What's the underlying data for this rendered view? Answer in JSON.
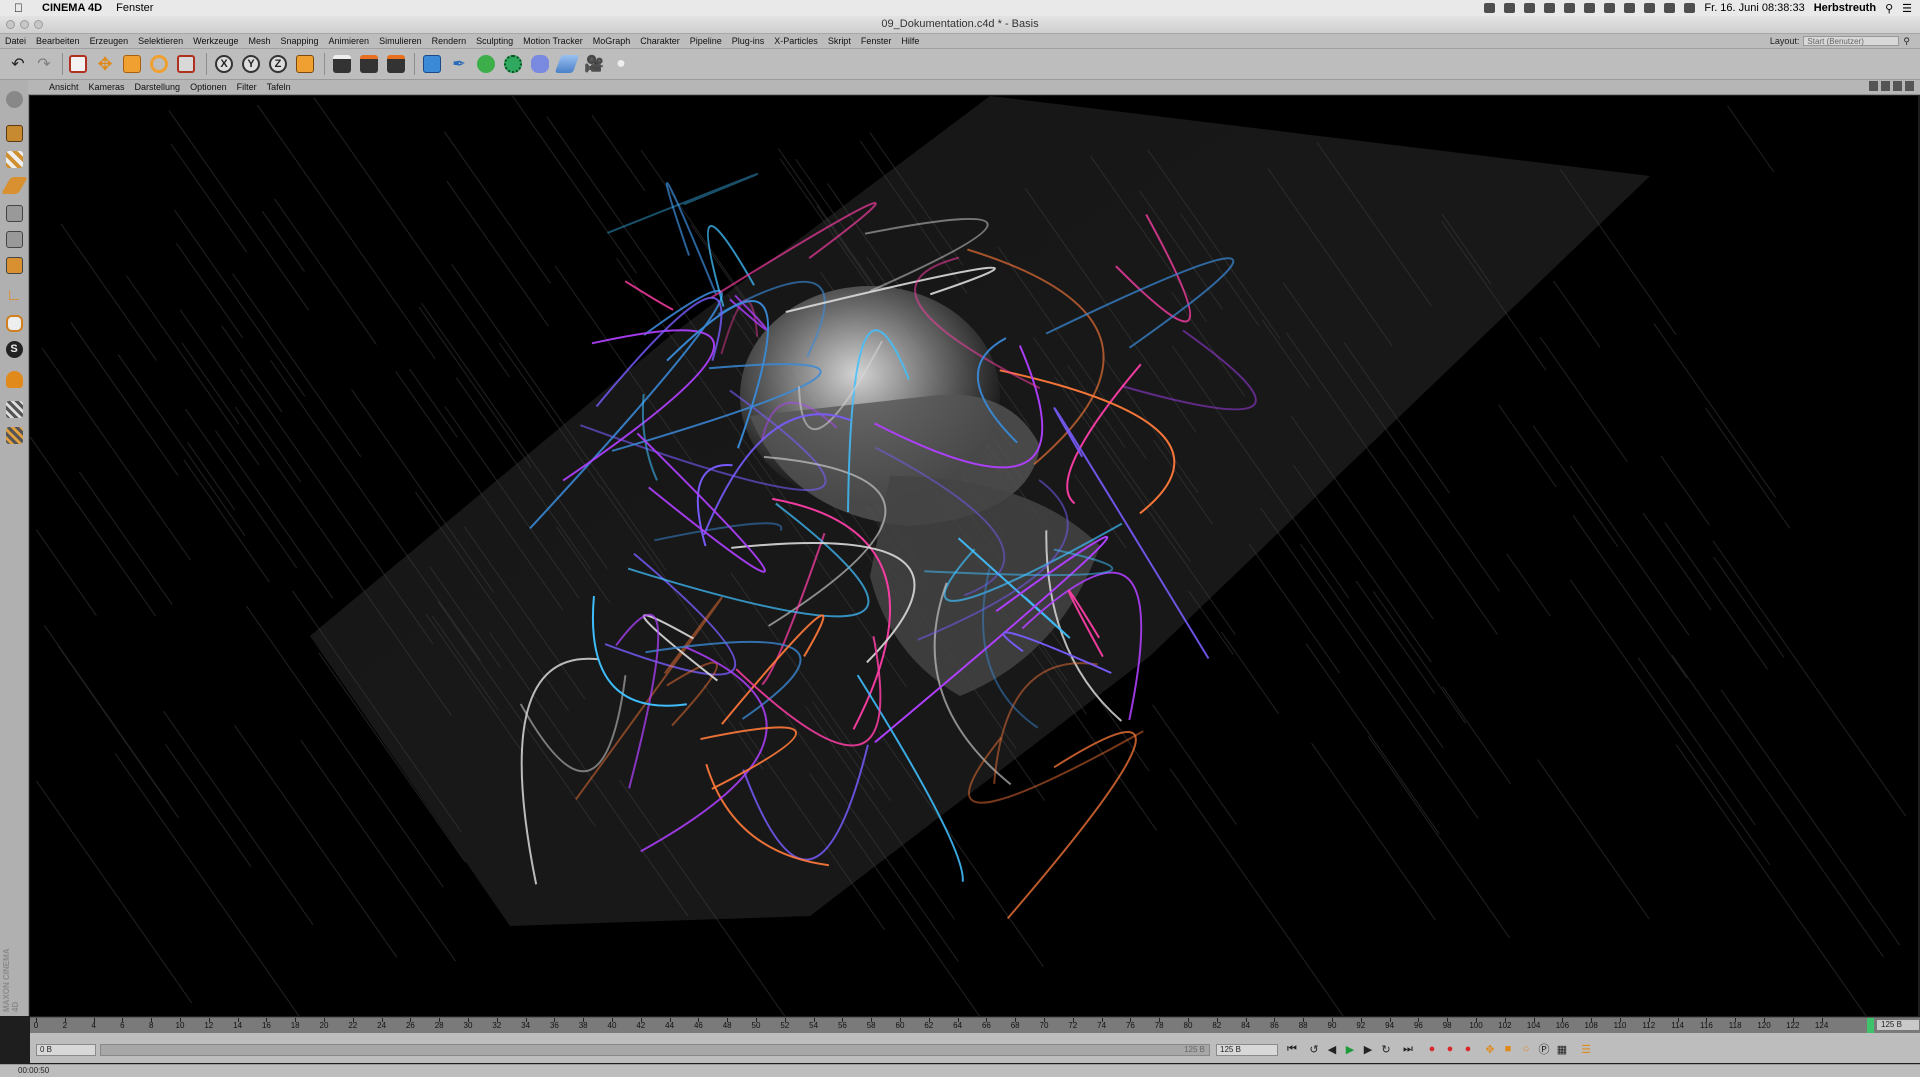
{
  "mac_menubar": {
    "app_name": "CINEMA 4D",
    "menu_item": "Fenster",
    "clock": "Fr. 16. Juni  08:38:33",
    "user": "Herbstreuth"
  },
  "window": {
    "title": "09_Dokumentation.c4d * - Basis"
  },
  "main_menu": {
    "items": [
      "Datei",
      "Bearbeiten",
      "Erzeugen",
      "Selektieren",
      "Werkzeuge",
      "Mesh",
      "Snapping",
      "Animieren",
      "Simulieren",
      "Rendern",
      "Sculpting",
      "Motion Tracker",
      "MoGraph",
      "Charakter",
      "Pipeline",
      "Plug-ins",
      "X-Particles",
      "Skript",
      "Fenster",
      "Hilfe"
    ],
    "layout_label": "Layout:",
    "layout_value": "Start (Benutzer)"
  },
  "toolbar": {
    "axis_labels": [
      "X",
      "Y",
      "Z"
    ]
  },
  "viewport_menu": {
    "items": [
      "Ansicht",
      "Kameras",
      "Darstellung",
      "Optionen",
      "Filter",
      "Tafeln"
    ]
  },
  "timeline": {
    "ticks": [
      "0",
      "2",
      "4",
      "6",
      "8",
      "10",
      "12",
      "14",
      "16",
      "18",
      "20",
      "22",
      "24",
      "26",
      "28",
      "30",
      "32",
      "34",
      "36",
      "38",
      "40",
      "42",
      "44",
      "46",
      "48",
      "50",
      "52",
      "54",
      "56",
      "58",
      "60",
      "62",
      "64",
      "66",
      "68",
      "70",
      "72",
      "74",
      "76",
      "78",
      "80",
      "82",
      "84",
      "86",
      "88",
      "90",
      "92",
      "94",
      "96",
      "98",
      "100",
      "102",
      "104",
      "106",
      "108",
      "110",
      "112",
      "114",
      "116",
      "118",
      "120",
      "122",
      "124"
    ],
    "end_value": "125 B",
    "current_frame": 125
  },
  "playbar": {
    "start_field": "0 B",
    "slider_end": "125 B",
    "end_field": "125 B"
  },
  "status": {
    "time": "00:00:50"
  },
  "branding": {
    "logo_text": "MAXON CINEMA 4D"
  },
  "colors": {
    "accent_orange": "#f0a030",
    "accent_blue": "#3a8ad8",
    "accent_green": "#3ec36a",
    "record_red": "#d8282a",
    "ui_gray": "#bdbdbd"
  }
}
